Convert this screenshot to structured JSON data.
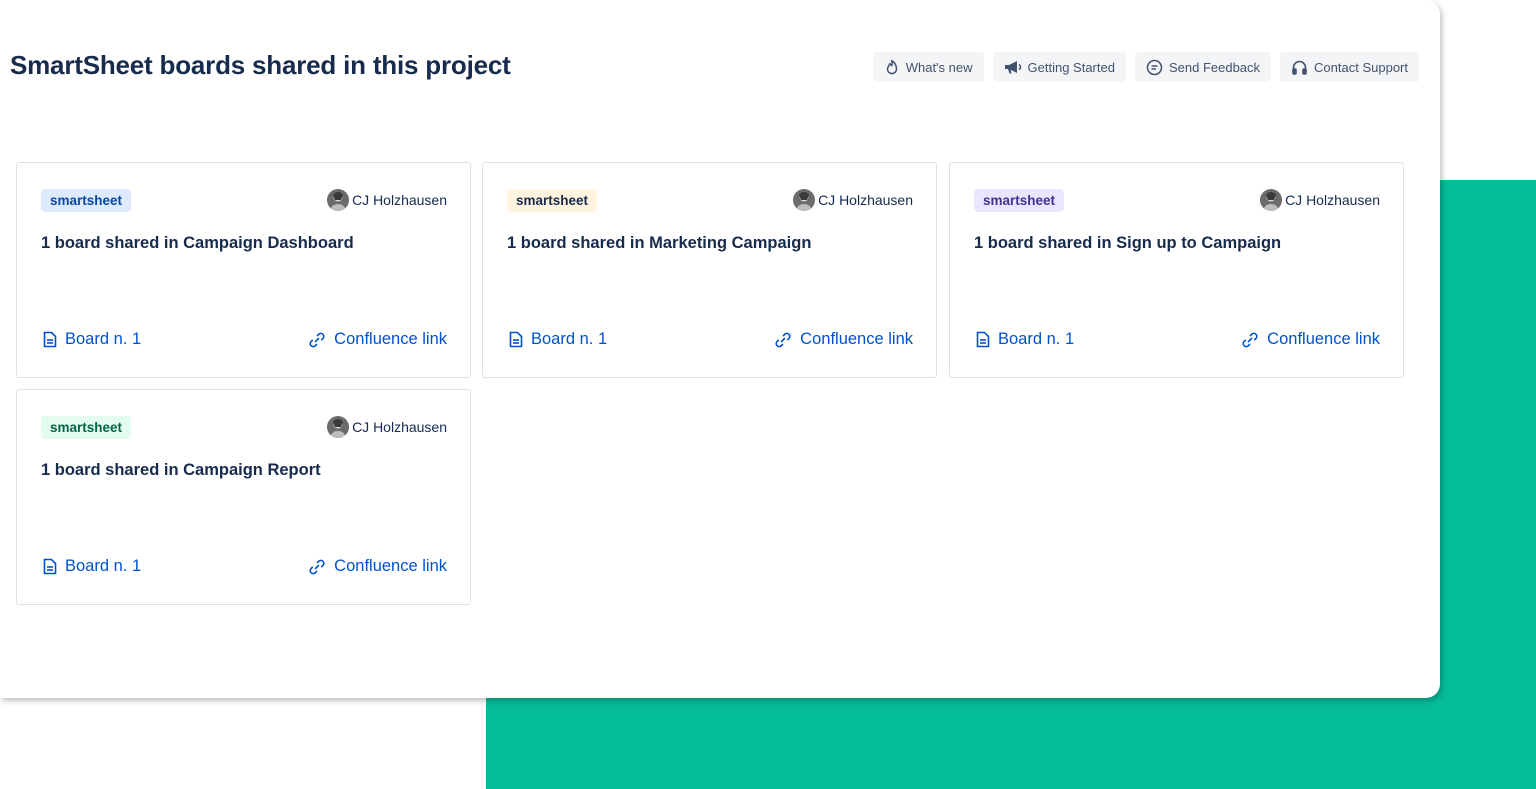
{
  "page": {
    "title": "SmartSheet boards shared in this project"
  },
  "actions": [
    {
      "label": "What's new",
      "icon": "fire-icon"
    },
    {
      "label": "Getting Started",
      "icon": "megaphone-icon"
    },
    {
      "label": "Send Feedback",
      "icon": "feedback-icon"
    },
    {
      "label": "Contact Support",
      "icon": "headset-icon"
    }
  ],
  "cards": [
    {
      "tag": "smartsheet",
      "tag_bg": "#deebff",
      "tag_color": "#0747a6",
      "author": "CJ Holzhausen",
      "title": "1 board shared in Campaign Dashboard",
      "board_link": "Board n. 1",
      "confluence_link": "Confluence link"
    },
    {
      "tag": "smartsheet",
      "tag_bg": "#fff4de",
      "tag_color": "#172b4d",
      "author": "CJ Holzhausen",
      "title": "1 board shared in Marketing Campaign",
      "board_link": "Board n. 1",
      "confluence_link": "Confluence link"
    },
    {
      "tag": "smartsheet",
      "tag_bg": "#eae6ff",
      "tag_color": "#403294",
      "author": "CJ Holzhausen",
      "title": "1 board shared in Sign up to Campaign",
      "board_link": "Board n. 1",
      "confluence_link": "Confluence link"
    },
    {
      "tag": "smartsheet",
      "tag_bg": "#e3fcef",
      "tag_color": "#006644",
      "author": "CJ Holzhausen",
      "title": "1 board shared in Campaign Report",
      "board_link": "Board n. 1",
      "confluence_link": "Confluence link"
    }
  ],
  "colors": {
    "background_accent": "#05bd98",
    "link": "#0052cc",
    "text": "#172b4d"
  }
}
